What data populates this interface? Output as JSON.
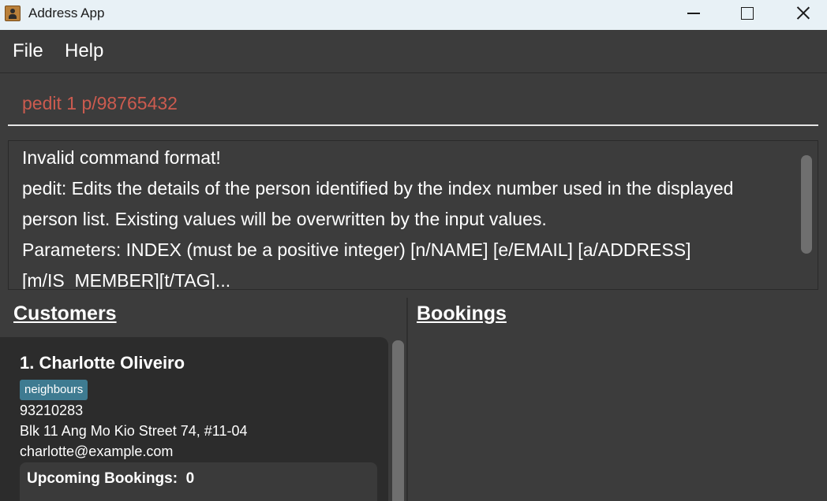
{
  "window": {
    "title": "Address App",
    "icon": "address-book-icon"
  },
  "menu": {
    "file": "File",
    "help": "Help"
  },
  "command": {
    "value": "pedit 1 p/98765432",
    "text_color": "#cc5b4f"
  },
  "result": {
    "lines": [
      "Invalid command format!",
      "pedit: Edits the details of the person identified by the index number used in the displayed",
      "person list. Existing values will be overwritten by the input values.",
      "Parameters: INDEX (must be a positive integer) [n/NAME] [e/EMAIL] [a/ADDRESS]",
      "[m/IS_MEMBER][t/TAG]..."
    ]
  },
  "panes": {
    "customers_title": "Customers",
    "bookings_title": "Bookings"
  },
  "customers": [
    {
      "heading": "1. Charlotte Oliveiro",
      "tags": [
        "neighbours"
      ],
      "phone": "93210283",
      "address": "Blk 11 Ang Mo Kio Street 74, #11-04",
      "email": "charlotte@example.com",
      "upcoming_label": "Upcoming Bookings:  0"
    }
  ],
  "colors": {
    "background": "#3c3c3c",
    "card": "#2c2c2c",
    "tag": "#3e7b91",
    "titlebar": "#e8f1f6"
  }
}
